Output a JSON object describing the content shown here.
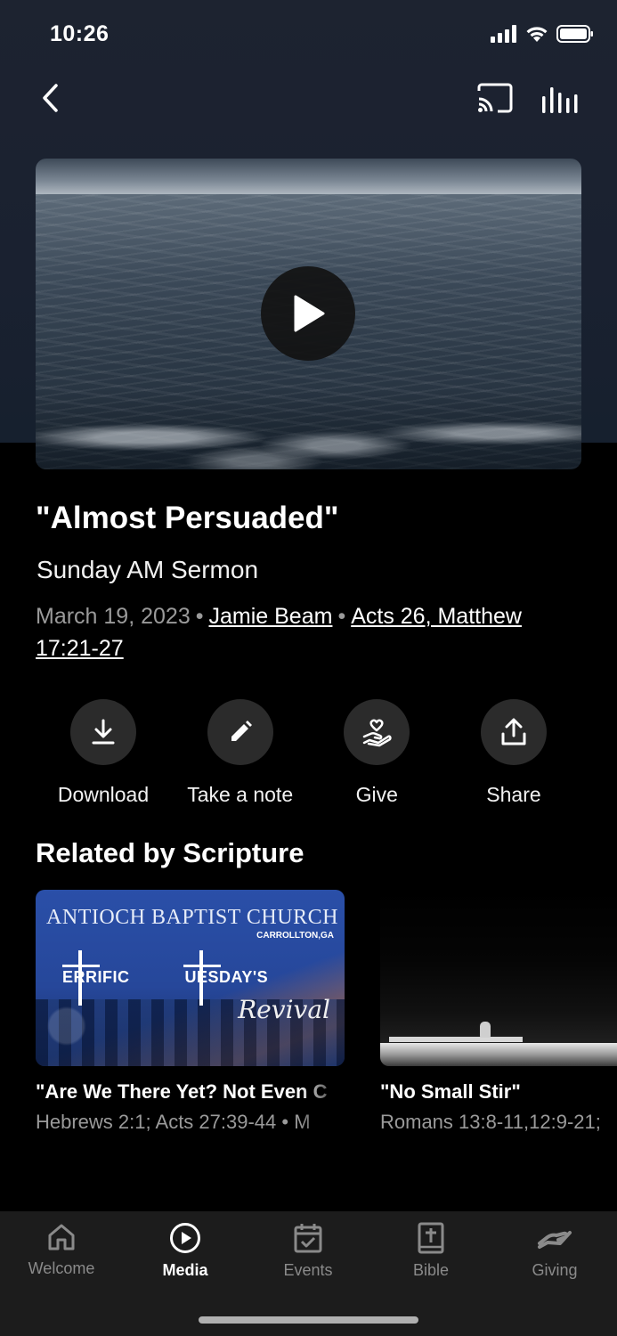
{
  "status_bar": {
    "time": "10:26"
  },
  "header": {
    "back_icon": "chevron-left-icon",
    "cast_icon": "cast-icon",
    "audio_icon": "audio-bars-icon"
  },
  "media": {
    "title": "\"Almost Persuaded\"",
    "subtitle": "Sunday AM Sermon",
    "date": "March 19, 2023",
    "speaker": "Jamie Beam",
    "scripture": "Acts 26, Matthew 17:21-27"
  },
  "actions": [
    {
      "label": "Download",
      "icon": "download-icon"
    },
    {
      "label": "Take a note",
      "icon": "pencil-icon"
    },
    {
      "label": "Give",
      "icon": "give-heart-hand-icon"
    },
    {
      "label": "Share",
      "icon": "share-icon"
    }
  ],
  "related": {
    "section_title": "Related by Scripture",
    "items": [
      {
        "title": "\"Are We There Yet? Not Even C",
        "meta": "Hebrews 2:1; Acts 27:39-44 • M",
        "thumb_church": "ANTIOCH BAPTIST CHURCH",
        "thumb_location": "CARROLLTON,GA",
        "thumb_line1": "ERRIFIC",
        "thumb_line2": "UESDAY'S",
        "thumb_revival": "Revival"
      },
      {
        "title": "\"No Small Stir\"",
        "meta": "Romans 13:8-11,12:9-21;"
      }
    ]
  },
  "tabs": [
    {
      "label": "Welcome",
      "icon": "home-icon",
      "active": false
    },
    {
      "label": "Media",
      "icon": "play-circle-icon",
      "active": true
    },
    {
      "label": "Events",
      "icon": "calendar-check-icon",
      "active": false
    },
    {
      "label": "Bible",
      "icon": "bible-icon",
      "active": false
    },
    {
      "label": "Giving",
      "icon": "giving-hand-icon",
      "active": false
    }
  ]
}
